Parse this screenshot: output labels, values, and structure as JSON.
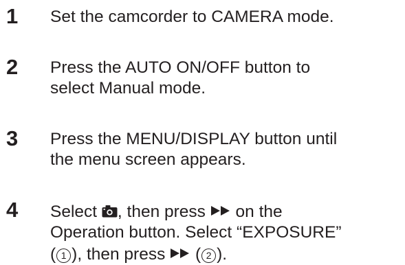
{
  "steps": [
    {
      "number": "1",
      "line1": "Set the camcorder to CAMERA mode."
    },
    {
      "number": "2",
      "line1": "Press the AUTO ON/OFF button to",
      "line2": "select Manual mode."
    },
    {
      "number": "3",
      "line1": "Press the MENU/DISPLAY button until",
      "line2": "the menu screen appears."
    },
    {
      "number": "4",
      "line1_a": "Select ",
      "line1_b": ", then press ",
      "line1_c": " on the",
      "line2": "Operation button. Select “EXPOSURE”",
      "line3_a": "(",
      "line3_circ1": "1",
      "line3_b": "), then press ",
      "line3_c": " (",
      "line3_circ2": "2",
      "line3_d": ")."
    }
  ],
  "icons": {
    "camera": "camera-icon",
    "fast_forward": "fast-forward-icon"
  },
  "colors": {
    "text": "#231f20",
    "background": "#ffffff"
  }
}
